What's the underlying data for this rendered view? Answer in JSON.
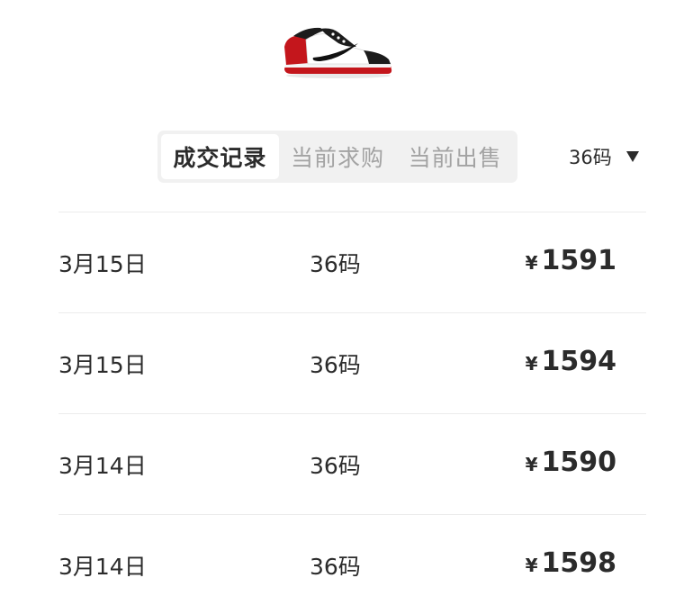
{
  "product": {
    "image_icon": "sneaker-image"
  },
  "tabs": [
    {
      "label": "成交记录",
      "active": true
    },
    {
      "label": "当前求购",
      "active": false
    },
    {
      "label": "当前出售",
      "active": false
    }
  ],
  "size_filter": {
    "value": "36码",
    "icon": "caret-down-icon"
  },
  "currency_symbol": "¥",
  "records": [
    {
      "date": "3月15日",
      "size": "36码",
      "price": "1591"
    },
    {
      "date": "3月15日",
      "size": "36码",
      "price": "1594"
    },
    {
      "date": "3月14日",
      "size": "36码",
      "price": "1590"
    },
    {
      "date": "3月14日",
      "size": "36码",
      "price": "1598"
    }
  ],
  "colors": {
    "text": "#2b2b2b",
    "muted": "#a3a3a3",
    "segment_bg": "#f1f1f1",
    "divider": "#ececec",
    "shoe_red": "#c4161c"
  }
}
